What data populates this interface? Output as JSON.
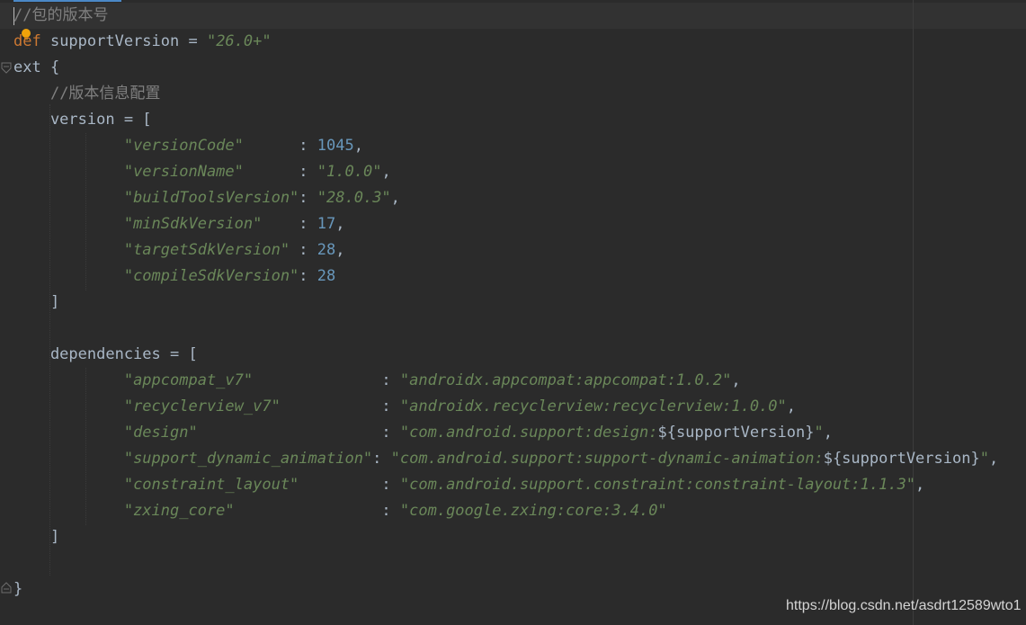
{
  "editor": {
    "lines": [
      {
        "id": 1,
        "tokens": [
          {
            "t": "//包的版本号",
            "c": "comment"
          }
        ]
      },
      {
        "id": 2,
        "tokens": [
          {
            "t": "def",
            "c": "kw"
          },
          {
            "t": " supportVersion = ",
            "c": "plain"
          },
          {
            "t": "\"26.0+\"",
            "c": "str"
          }
        ]
      },
      {
        "id": 3,
        "tokens": [
          {
            "t": "ext {",
            "c": "plain"
          }
        ]
      },
      {
        "id": 4,
        "tokens": [
          {
            "t": "    ",
            "c": "plain"
          },
          {
            "t": "//版本信息配置",
            "c": "comment"
          }
        ]
      },
      {
        "id": 5,
        "tokens": [
          {
            "t": "    version = [",
            "c": "plain"
          }
        ]
      },
      {
        "id": 6,
        "tokens": [
          {
            "t": "            ",
            "c": "plain"
          },
          {
            "t": "\"versionCode\"",
            "c": "str"
          },
          {
            "t": "      : ",
            "c": "plain"
          },
          {
            "t": "1045",
            "c": "num"
          },
          {
            "t": ",",
            "c": "plain"
          }
        ]
      },
      {
        "id": 7,
        "tokens": [
          {
            "t": "            ",
            "c": "plain"
          },
          {
            "t": "\"versionName\"",
            "c": "str"
          },
          {
            "t": "      : ",
            "c": "plain"
          },
          {
            "t": "\"1.0.0\"",
            "c": "str"
          },
          {
            "t": ",",
            "c": "plain"
          }
        ]
      },
      {
        "id": 8,
        "tokens": [
          {
            "t": "            ",
            "c": "plain"
          },
          {
            "t": "\"buildToolsVersion\"",
            "c": "str"
          },
          {
            "t": ": ",
            "c": "plain"
          },
          {
            "t": "\"28.0.3\"",
            "c": "str"
          },
          {
            "t": ",",
            "c": "plain"
          }
        ]
      },
      {
        "id": 9,
        "tokens": [
          {
            "t": "            ",
            "c": "plain"
          },
          {
            "t": "\"minSdkVersion\"",
            "c": "str"
          },
          {
            "t": "    : ",
            "c": "plain"
          },
          {
            "t": "17",
            "c": "num"
          },
          {
            "t": ",",
            "c": "plain"
          }
        ]
      },
      {
        "id": 10,
        "tokens": [
          {
            "t": "            ",
            "c": "plain"
          },
          {
            "t": "\"targetSdkVersion\"",
            "c": "str"
          },
          {
            "t": " : ",
            "c": "plain"
          },
          {
            "t": "28",
            "c": "num"
          },
          {
            "t": ",",
            "c": "plain"
          }
        ]
      },
      {
        "id": 11,
        "tokens": [
          {
            "t": "            ",
            "c": "plain"
          },
          {
            "t": "\"compileSdkVersion\"",
            "c": "str"
          },
          {
            "t": ": ",
            "c": "plain"
          },
          {
            "t": "28",
            "c": "num"
          }
        ]
      },
      {
        "id": 12,
        "tokens": [
          {
            "t": "    ]",
            "c": "plain"
          }
        ]
      },
      {
        "id": 13,
        "tokens": []
      },
      {
        "id": 14,
        "tokens": [
          {
            "t": "    dependencies = [",
            "c": "plain"
          }
        ]
      },
      {
        "id": 15,
        "tokens": [
          {
            "t": "            ",
            "c": "plain"
          },
          {
            "t": "\"appcompat_v7\"",
            "c": "str"
          },
          {
            "t": "              : ",
            "c": "plain"
          },
          {
            "t": "\"androidx.appcompat:appcompat:1.0.2\"",
            "c": "str"
          },
          {
            "t": ",",
            "c": "plain"
          }
        ]
      },
      {
        "id": 16,
        "tokens": [
          {
            "t": "            ",
            "c": "plain"
          },
          {
            "t": "\"recyclerview_v7\"",
            "c": "str"
          },
          {
            "t": "           : ",
            "c": "plain"
          },
          {
            "t": "\"androidx.recyclerview:recyclerview:1.0.0\"",
            "c": "str"
          },
          {
            "t": ",",
            "c": "plain"
          }
        ]
      },
      {
        "id": 17,
        "tokens": [
          {
            "t": "            ",
            "c": "plain"
          },
          {
            "t": "\"design\"",
            "c": "str"
          },
          {
            "t": "                    : ",
            "c": "plain"
          },
          {
            "t": "\"com.android.support:design:",
            "c": "str"
          },
          {
            "t": "${supportVersion}",
            "c": "plain"
          },
          {
            "t": "\"",
            "c": "str"
          },
          {
            "t": ",",
            "c": "plain"
          }
        ]
      },
      {
        "id": 18,
        "tokens": [
          {
            "t": "            ",
            "c": "plain"
          },
          {
            "t": "\"support_dynamic_animation\"",
            "c": "str"
          },
          {
            "t": ": ",
            "c": "plain"
          },
          {
            "t": "\"com.android.support:support-dynamic-animation:",
            "c": "str"
          },
          {
            "t": "${supportVersion}",
            "c": "plain"
          },
          {
            "t": "\"",
            "c": "str"
          },
          {
            "t": ",",
            "c": "plain"
          }
        ]
      },
      {
        "id": 19,
        "tokens": [
          {
            "t": "            ",
            "c": "plain"
          },
          {
            "t": "\"constraint_layout\"",
            "c": "str"
          },
          {
            "t": "         : ",
            "c": "plain"
          },
          {
            "t": "\"com.android.support.constraint:constraint-layout:1.1.3\"",
            "c": "str"
          },
          {
            "t": ",",
            "c": "plain"
          }
        ]
      },
      {
        "id": 20,
        "tokens": [
          {
            "t": "            ",
            "c": "plain"
          },
          {
            "t": "\"zxing_core\"",
            "c": "str"
          },
          {
            "t": "                : ",
            "c": "plain"
          },
          {
            "t": "\"com.google.zxing:core:3.4.0\"",
            "c": "str"
          }
        ]
      },
      {
        "id": 21,
        "tokens": [
          {
            "t": "    ]",
            "c": "plain"
          }
        ]
      },
      {
        "id": 22,
        "tokens": []
      },
      {
        "id": 23,
        "tokens": [
          {
            "t": "}",
            "c": "plain"
          }
        ]
      }
    ]
  },
  "watermark": "https://blog.csdn.net/asdrt12589wto1",
  "colors": {
    "background": "#2b2b2b",
    "comment": "#808080",
    "keyword": "#cc7832",
    "string": "#6a8759",
    "number": "#6897bb",
    "text": "#a9b7c6"
  }
}
